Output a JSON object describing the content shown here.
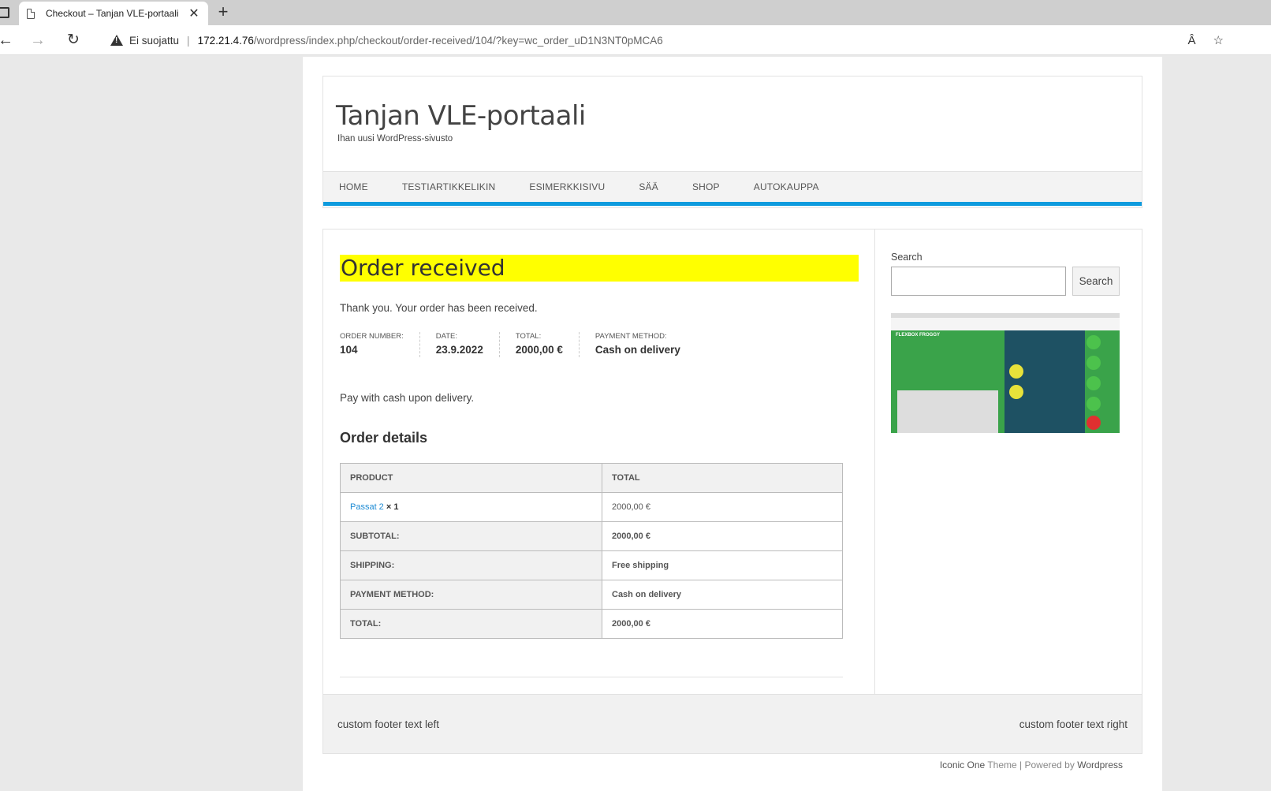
{
  "browser": {
    "tab_title": "Checkout – Tanjan VLE-portaali",
    "tab_close": "✕",
    "new_tab": "+",
    "insecure_label": "Ei suojattu",
    "url_host": "172.21.4.76",
    "url_path": "/wordpress/index.php/checkout/order-received/104/?key=wc_order_uD1N3NT0pMCA6",
    "read_aloud": "Â",
    "favorite": "☆"
  },
  "site": {
    "title": "Tanjan VLE-portaali",
    "tagline": "Ihan uusi WordPress-sivusto",
    "menu": [
      "HOME",
      "TESTIARTIKKELIKIN",
      "ESIMERKKISIVU",
      "SÄÄ",
      "SHOP",
      "AUTOKAUPPA"
    ],
    "accent": "#0e9bde"
  },
  "order": {
    "heading": "Order received",
    "thanks": "Thank you. Your order has been received.",
    "overview": [
      {
        "label": "ORDER NUMBER:",
        "value": "104"
      },
      {
        "label": "DATE:",
        "value": "23.9.2022"
      },
      {
        "label": "TOTAL:",
        "value": "2000,00 €"
      },
      {
        "label": "PAYMENT METHOD:",
        "value": "Cash on delivery"
      }
    ],
    "pay_note": "Pay with cash upon delivery.",
    "details_title": "Order details",
    "table": {
      "headers": [
        "PRODUCT",
        "TOTAL"
      ],
      "product_name": "Passat 2",
      "product_qty": "× 1",
      "product_total": "2000,00 €",
      "rows": [
        {
          "label": "SUBTOTAL:",
          "value": "2000,00 €"
        },
        {
          "label": "SHIPPING:",
          "value": "Free shipping"
        },
        {
          "label": "PAYMENT METHOD:",
          "value": "Cash on delivery"
        },
        {
          "label": "TOTAL:",
          "value": "2000,00 €"
        }
      ]
    }
  },
  "sidebar": {
    "search_label": "Search",
    "search_button": "Search",
    "thumb_title": "FLEXBOX FROGGY"
  },
  "footer": {
    "left": "custom footer text left",
    "right": "custom footer text right",
    "credits_theme": "Iconic One",
    "credits_theme_word": "Theme",
    "credits_sep": "|",
    "credits_powered": "Powered by",
    "credits_wp": "Wordpress"
  }
}
